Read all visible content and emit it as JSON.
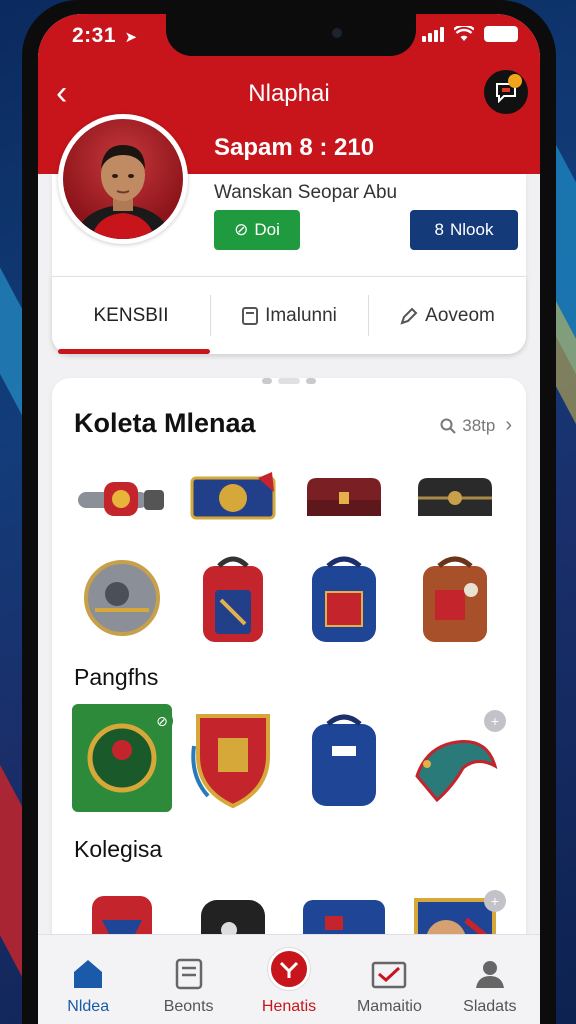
{
  "status": {
    "time": "2:31"
  },
  "header": {
    "title": "Nlaphai"
  },
  "profile": {
    "score": "Sapam 8 : 210",
    "subtitle": "Wanskan Seopar Abu",
    "green_button": "Doi",
    "blue_button": "Nlook"
  },
  "tabs": [
    {
      "label": "KENSBII"
    },
    {
      "label": "Imalunni"
    },
    {
      "label": "Aoveom"
    }
  ],
  "collection": {
    "title": "Koleta Mlenaa",
    "search_label": "38tp",
    "section2": "Pangfhs",
    "section3": "Kolegisa"
  },
  "nav": [
    {
      "label": "Nldea"
    },
    {
      "label": "Beonts"
    },
    {
      "label": "Henatis"
    },
    {
      "label": "Mamaitio"
    },
    {
      "label": "Sladats"
    }
  ],
  "colors": {
    "brand_red": "#c8141b",
    "green": "#1f9a3e",
    "navy": "#143a7a"
  }
}
